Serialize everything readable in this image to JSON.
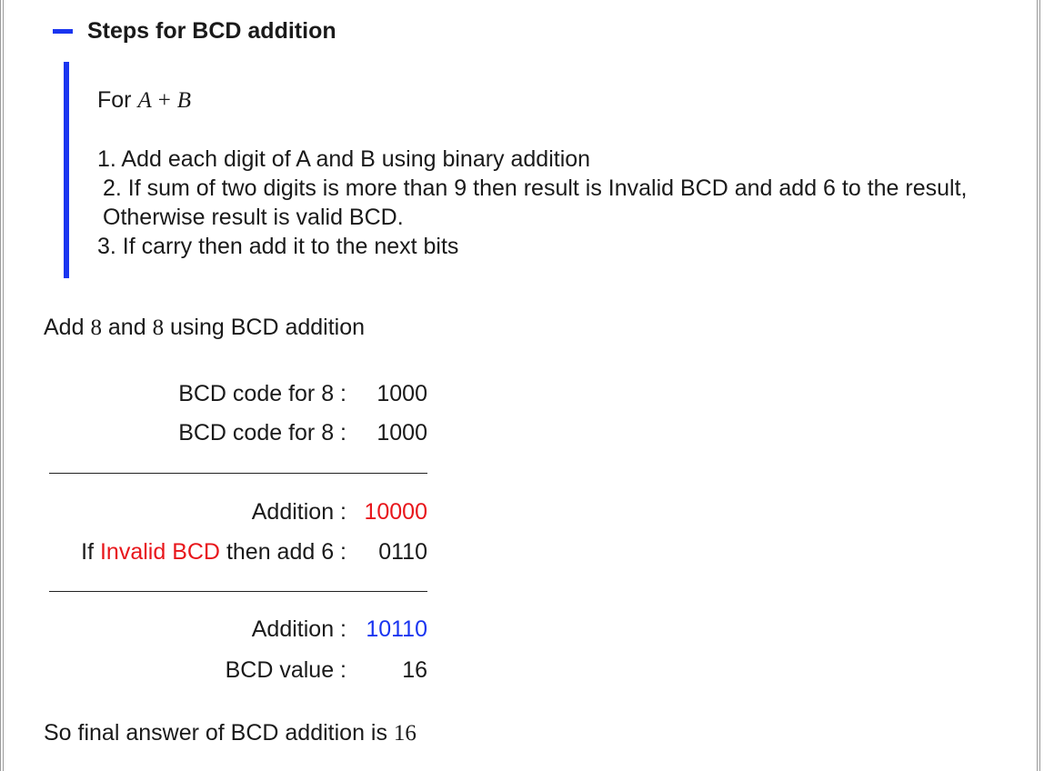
{
  "section": {
    "title": "Steps for BCD addition",
    "toggle_icon": "collapse-minus-icon"
  },
  "steps": {
    "for_prefix": "For",
    "expr_a": "A",
    "expr_op": "+",
    "expr_b": "B",
    "items": [
      "1. Add each digit of A and B using binary addition",
      "2. If sum of two digits is more than 9 then result is Invalid BCD and add 6 to the result, Otherwise result is valid BCD.",
      "3. If carry then add it to the next bits"
    ]
  },
  "problem": {
    "prefix": "Add",
    "a": "8",
    "mid": "and",
    "b": "8",
    "suffix": "using BCD addition"
  },
  "calculation": {
    "row1": {
      "label": "BCD code for 8 :",
      "value": "1000"
    },
    "row2": {
      "label": "BCD code for 8 :",
      "value": "1000"
    },
    "row3": {
      "label": "Addition :",
      "value": "10000"
    },
    "row4": {
      "label_prefix": "If",
      "label_highlight": "Invalid BCD",
      "label_suffix": "then add 6 :",
      "value": "0110"
    },
    "row5": {
      "label": "Addition :",
      "value": "10110"
    },
    "row6": {
      "label": "BCD value :",
      "value": "16"
    }
  },
  "final": {
    "text": "So final answer of BCD addition is",
    "value": "16"
  },
  "colors": {
    "accent_blue": "#1a35f0",
    "highlight_red": "#e8161b"
  }
}
